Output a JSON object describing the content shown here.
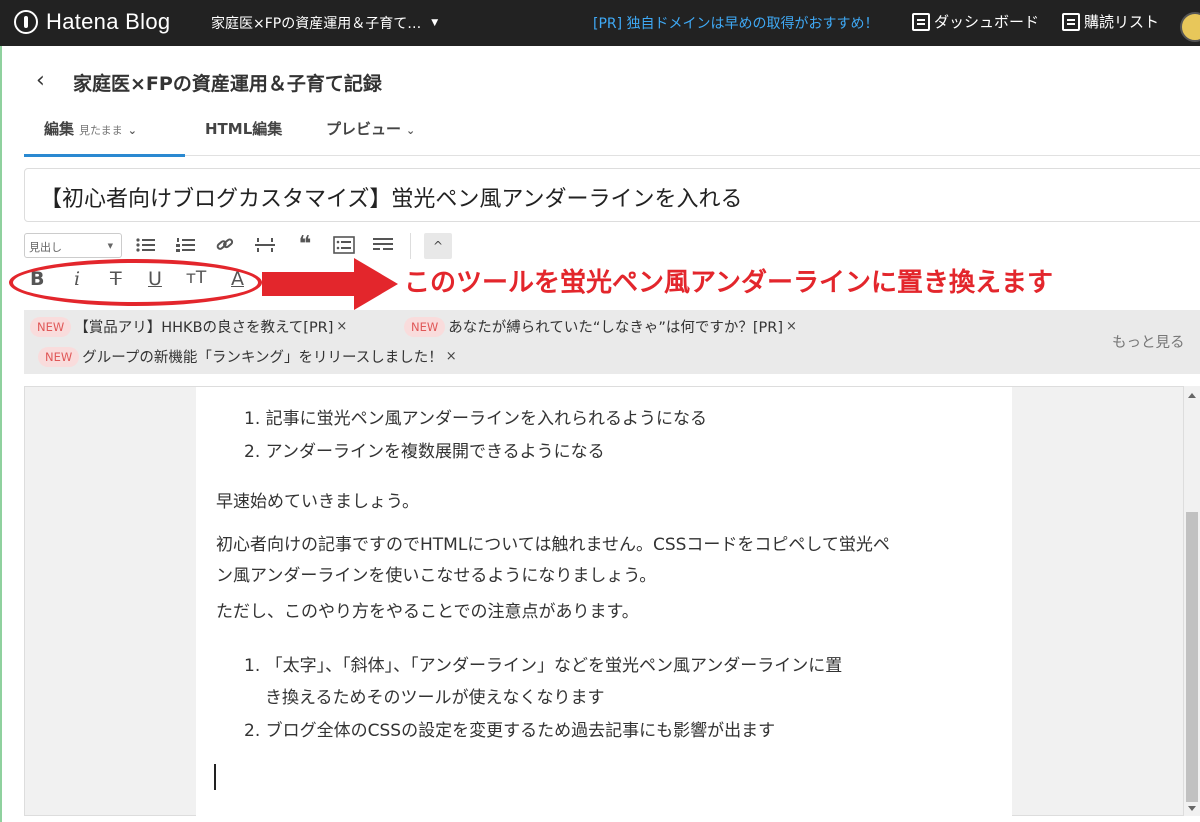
{
  "topbar": {
    "logo_text": "Hatena Blog",
    "blog_selector": "家庭医×FPの資産運用＆子育て…",
    "pr_text": "[PR] 独自ドメインは早めの取得がおすすめ！",
    "dashboard_label": "ダッシュボード",
    "reading_list_label": "購読リスト"
  },
  "header": {
    "back_glyph": "‹",
    "blog_title": "家庭医×FPの資産運用＆子育て記録"
  },
  "tabs": [
    {
      "label": "編集",
      "sub": "見たまま",
      "chev": "⌄"
    },
    {
      "label": "HTML編集"
    },
    {
      "label": "プレビュー",
      "chev": "⌄"
    }
  ],
  "title_input": {
    "value": "【初心者向けブログカスタマイズ】蛍光ペン風アンダーラインを入れる"
  },
  "toolbar": {
    "heading_select": "見出し",
    "icons": [
      "bullet-list-icon",
      "numbered-list-icon",
      "link-icon",
      "page-break-icon",
      "quote-icon",
      "table-of-contents-icon",
      "more-icon"
    ],
    "collapse_glyph": "^",
    "format_buttons": [
      {
        "name": "bold-icon",
        "glyph": "B"
      },
      {
        "name": "italic-icon",
        "glyph": "i"
      },
      {
        "name": "strikethrough-icon",
        "glyph": "T"
      },
      {
        "name": "underline-icon",
        "glyph": "U"
      },
      {
        "name": "font-size-icon",
        "glyph": "тT"
      },
      {
        "name": "text-color-icon",
        "glyph": "A"
      }
    ]
  },
  "annotation": {
    "text": "このツールを蛍光ペン風アンダーラインに置き換えます",
    "color": "#e3262c"
  },
  "news": {
    "new_badge": "NEW",
    "items": [
      "【賞品アリ】HHKBの良さを教えて[PR]",
      "あなたが縛られていた“しなきゃ”は何ですか？[PR]",
      "グループの新機能「ランキング」をリリースしました！"
    ],
    "close_glyph": "×",
    "more_label": "もっと見る"
  },
  "editor": {
    "list1": [
      "1. 記事に蛍光ペン風アンダーラインを入れられるようになる",
      "2. アンダーラインを複数展開できるようになる"
    ],
    "para1": "早速始めていきましょう。",
    "para2_line1": "初心者向けの記事ですのでHTMLについては触れません。CSSコードをコピペして蛍光ペ",
    "para2_line2": "ン風アンダーラインを使いこなせるようになりましょう。",
    "para3": "ただし、このやり方をやることでの注意点があります。",
    "list2_item1_line1": "1. 「太字」、「斜体」、「アンダーライン」などを蛍光ペン風アンダーラインに置",
    "list2_item1_line2": "き換えるためそのツールが使えなくなります",
    "list2_item2": "2. ブログ全体のCSSの設定を変更するため過去記事にも影響が出ます"
  }
}
